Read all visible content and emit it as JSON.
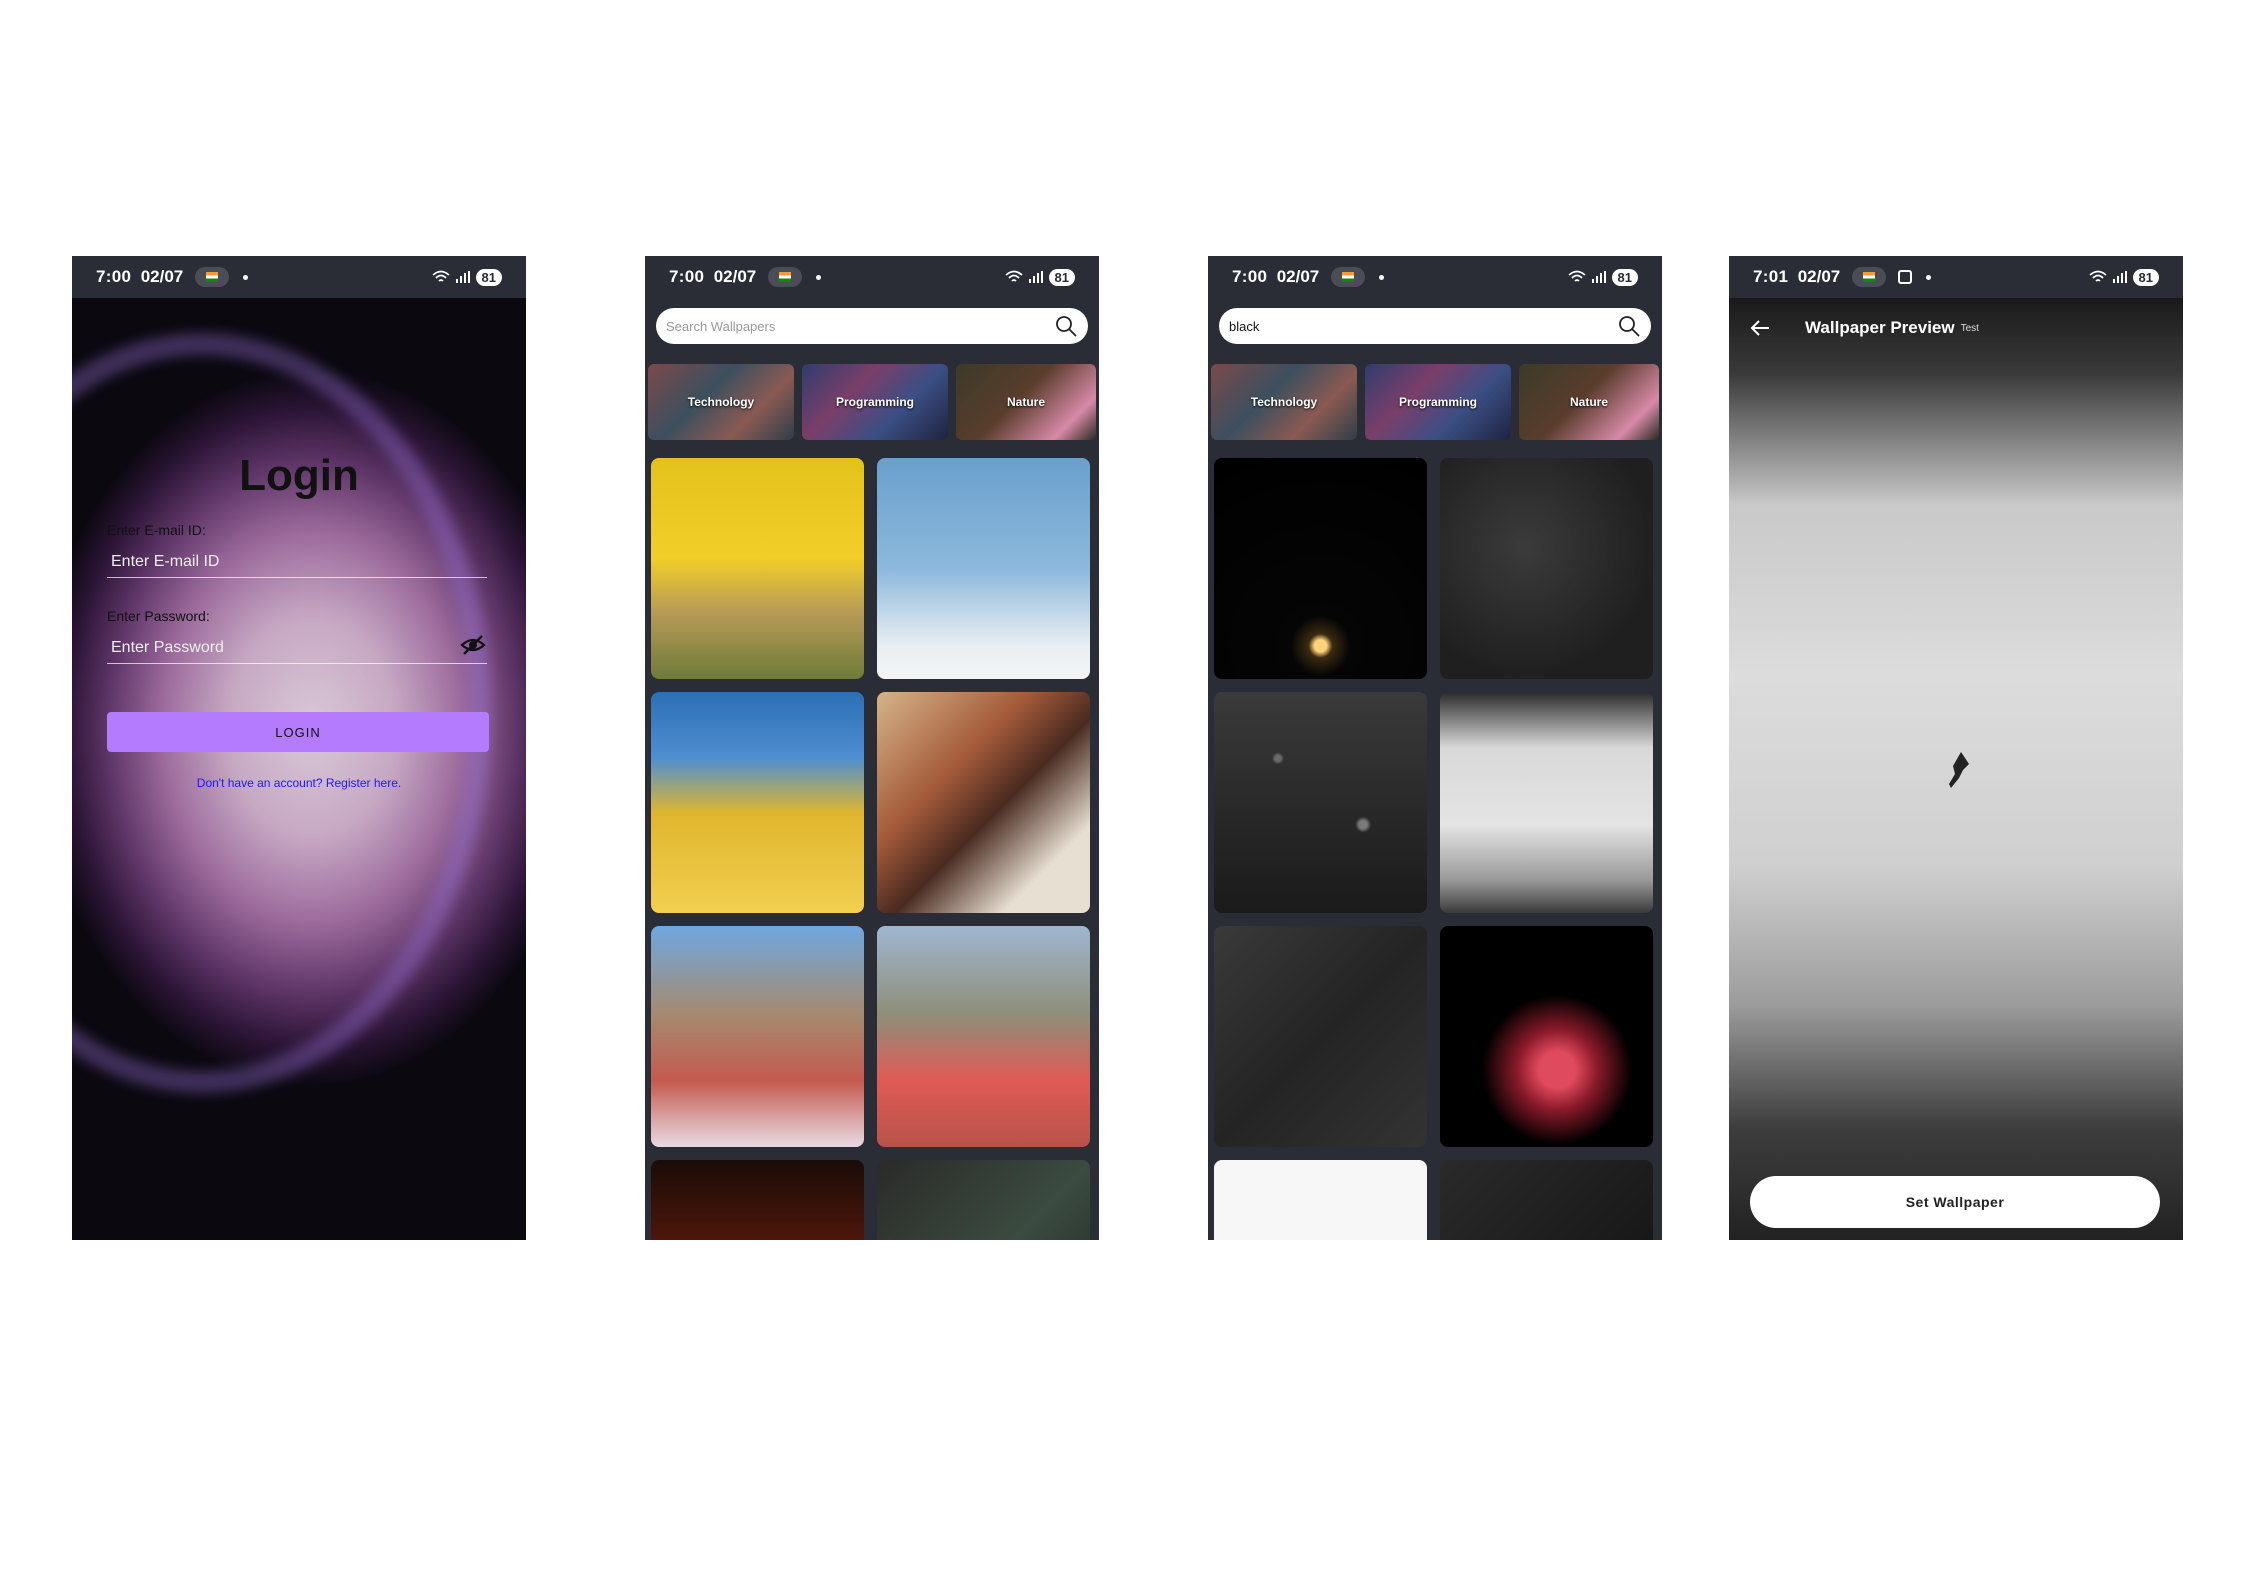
{
  "status": {
    "time_a": "7:00",
    "time_b": "7:01",
    "date": "02/07",
    "battery": "81"
  },
  "login": {
    "title": "Login",
    "email_label": "Enter E-mail ID:",
    "email_placeholder": "Enter E-mail ID",
    "password_label": "Enter Password:",
    "password_placeholder": "Enter Password",
    "button": "LOGIN",
    "register_link": "Don't have an account? Register here."
  },
  "home": {
    "search_placeholder": "Search Wallpapers",
    "categories": [
      "Technology",
      "Programming",
      "Nature"
    ]
  },
  "search": {
    "query": "black"
  },
  "preview": {
    "title": "Wallpaper Preview",
    "subtitle": "Test",
    "button": "Set Wallpaper"
  },
  "colors": {
    "login_button": "#b57bff",
    "link": "#1a1aff",
    "statusbar": "#2a2d35"
  },
  "icons": [
    "search-icon",
    "eye-off-icon",
    "back-arrow-icon",
    "wifi-icon",
    "signal-icon",
    "flag-icon",
    "screenshot-icon"
  ]
}
